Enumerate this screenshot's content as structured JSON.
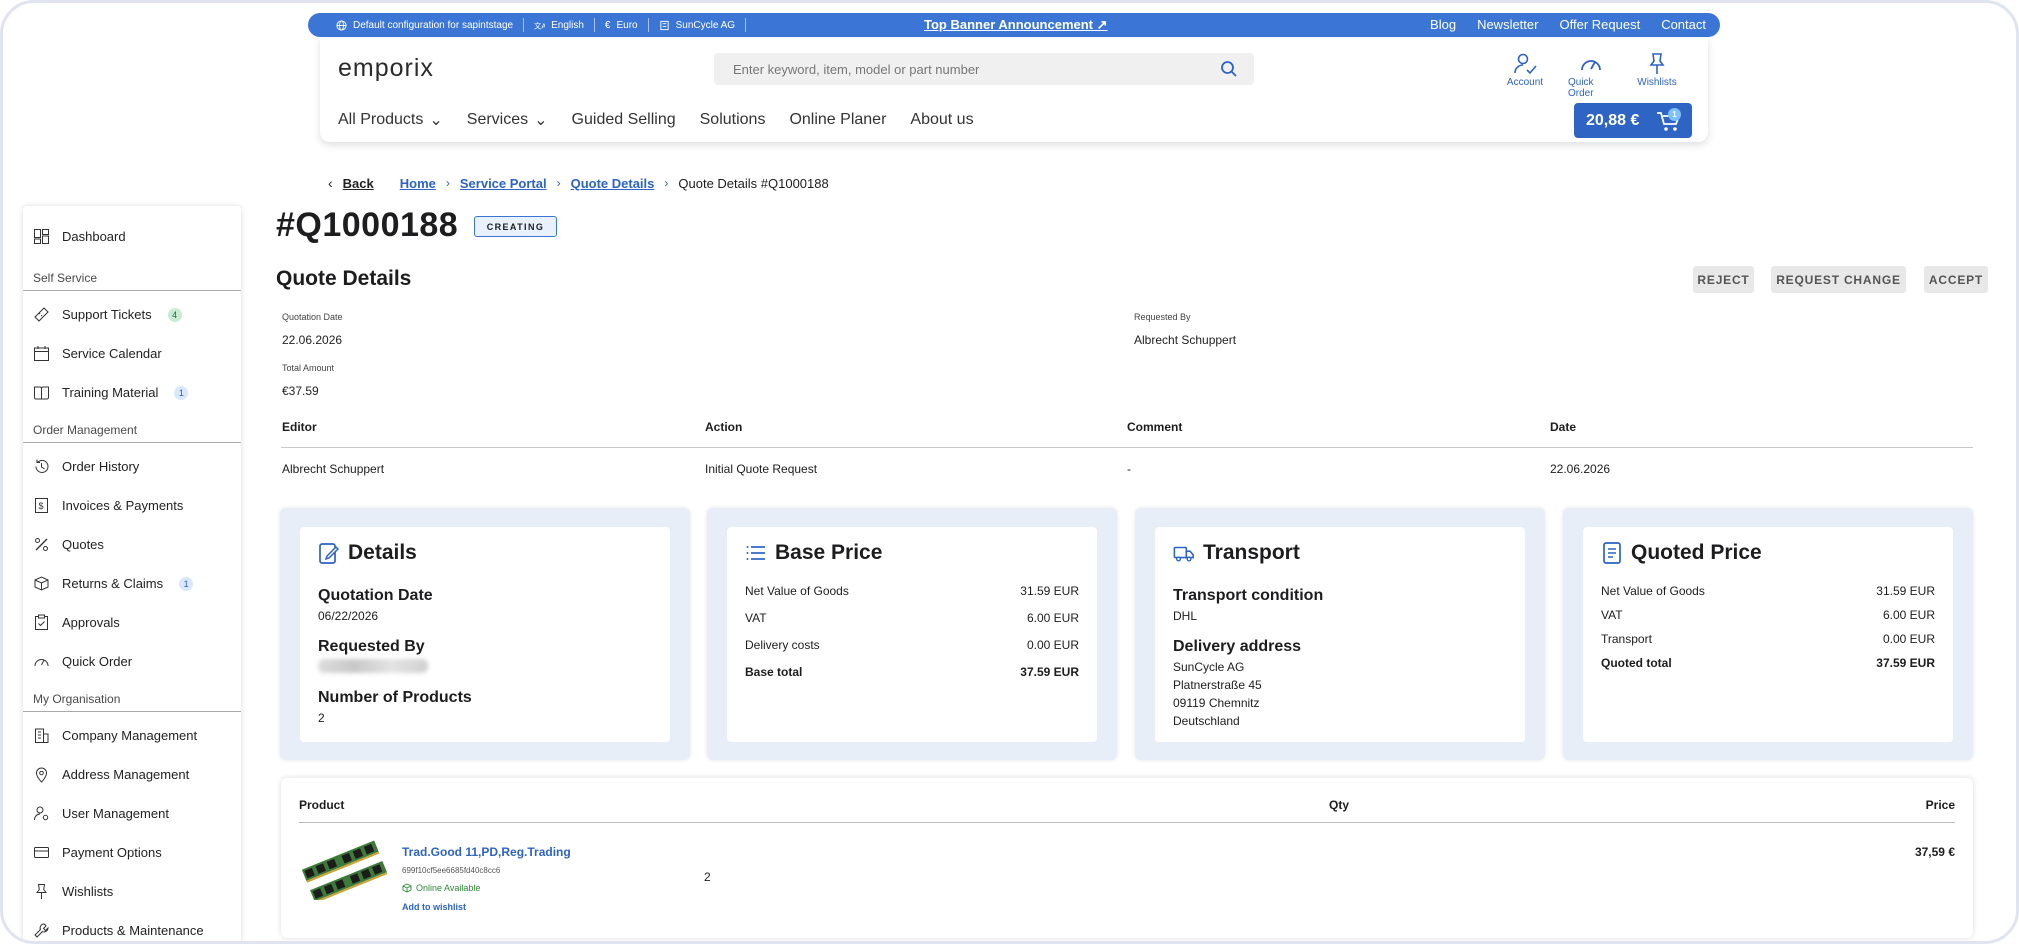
{
  "topbar": {
    "config": "Default configuration for sapintstage",
    "language": "English",
    "currency": "Euro",
    "company": "SunCycle AG",
    "announcement": "Top Banner Announcement ↗",
    "links": [
      "Blog",
      "Newsletter",
      "Offer Request",
      "Contact"
    ]
  },
  "header": {
    "logo": "emporix",
    "search_placeholder": "Enter keyword, item, model or part number",
    "icons": [
      {
        "label": "Account",
        "icon": "account-icon"
      },
      {
        "label": "Quick Order",
        "icon": "speedometer-icon"
      },
      {
        "label": "Wishlists",
        "icon": "pin-icon"
      }
    ],
    "nav": [
      {
        "label": "All Products",
        "dropdown": true
      },
      {
        "label": "Services",
        "dropdown": true
      },
      {
        "label": "Guided Selling",
        "dropdown": false
      },
      {
        "label": "Solutions",
        "dropdown": false
      },
      {
        "label": "Online Planer",
        "dropdown": false
      },
      {
        "label": "About us",
        "dropdown": false
      }
    ],
    "cart_total": "20,88 €",
    "cart_count": "1"
  },
  "breadcrumb": {
    "back": "Back",
    "items": [
      "Home",
      "Service Portal",
      "Quote Details"
    ],
    "current": "Quote Details #Q1000188"
  },
  "sidebar": {
    "dashboard": "Dashboard",
    "sections": [
      {
        "title": "Self Service",
        "items": [
          {
            "label": "Support Tickets",
            "badge": "4"
          },
          {
            "label": "Service Calendar",
            "badge": ""
          },
          {
            "label": "Training Material",
            "badge": "1"
          }
        ]
      },
      {
        "title": "Order Management",
        "items": [
          {
            "label": "Order History",
            "badge": ""
          },
          {
            "label": "Invoices & Payments",
            "badge": ""
          },
          {
            "label": "Quotes",
            "badge": ""
          },
          {
            "label": "Returns & Claims",
            "badge": "1"
          },
          {
            "label": "Approvals",
            "badge": ""
          },
          {
            "label": "Quick Order",
            "badge": ""
          }
        ]
      },
      {
        "title": "My Organisation",
        "items": [
          {
            "label": "Company Management",
            "badge": ""
          },
          {
            "label": "Address Management",
            "badge": ""
          },
          {
            "label": "User Management",
            "badge": ""
          },
          {
            "label": "Payment Options",
            "badge": ""
          },
          {
            "label": "Wishlists",
            "badge": ""
          },
          {
            "label": "Products & Maintenance",
            "badge": ""
          }
        ]
      }
    ]
  },
  "quote": {
    "number": "#Q1000188",
    "status": "CREATING",
    "section_title": "Quote Details",
    "actions": [
      "REJECT",
      "REQUEST CHANGE",
      "ACCEPT"
    ],
    "quotation_date_label": "Quotation Date",
    "quotation_date": "22.06.2026",
    "requested_by_label": "Requested By",
    "requested_by": "Albrecht Schuppert",
    "total_amount_label": "Total Amount",
    "total_amount": "€37.59"
  },
  "history": {
    "headers": [
      "Editor",
      "Action",
      "Comment",
      "Date"
    ],
    "rows": [
      [
        "Albrecht Schuppert",
        "Initial Quote Request",
        "-",
        "22.06.2026"
      ]
    ]
  },
  "cards": {
    "details": {
      "title": "Details",
      "quotation_date_label": "Quotation Date",
      "quotation_date": "06/22/2026",
      "requested_by_label": "Requested By",
      "number_of_products_label": "Number of Products",
      "number_of_products": "2"
    },
    "base_price": {
      "title": "Base Price",
      "rows": [
        {
          "label": "Net Value of Goods",
          "value": "31.59 EUR"
        },
        {
          "label": "VAT",
          "value": "6.00 EUR"
        },
        {
          "label": "Delivery costs",
          "value": "0.00 EUR"
        },
        {
          "label": "Base total",
          "value": "37.59 EUR"
        }
      ]
    },
    "transport": {
      "title": "Transport",
      "condition_label": "Transport condition",
      "condition": "DHL",
      "address_label": "Delivery address",
      "address": [
        "SunCycle AG",
        "Platnerstraße 45",
        "09119 Chemnitz",
        "Deutschland"
      ]
    },
    "quoted_price": {
      "title": "Quoted Price",
      "rows": [
        {
          "label": "Net Value of Goods",
          "value": "31.59 EUR"
        },
        {
          "label": "VAT",
          "value": "6.00 EUR"
        },
        {
          "label": "Transport",
          "value": "0.00 EUR"
        },
        {
          "label": "Quoted total",
          "value": "37.59 EUR"
        }
      ]
    }
  },
  "products": {
    "headers": [
      "Product",
      "Qty",
      "Price"
    ],
    "items": [
      {
        "name": "Trad.Good 11,PD,Reg.Trading",
        "sku": "699f10cf5ee6685fd40c8cc6",
        "availability": "Online Available",
        "wishlist": "Add to wishlist",
        "qty": "2",
        "price": "37,59 €"
      }
    ]
  },
  "colors": {
    "accent": "#3b76d6",
    "link": "#2d63c3",
    "card_bg": "#e8eef7"
  }
}
